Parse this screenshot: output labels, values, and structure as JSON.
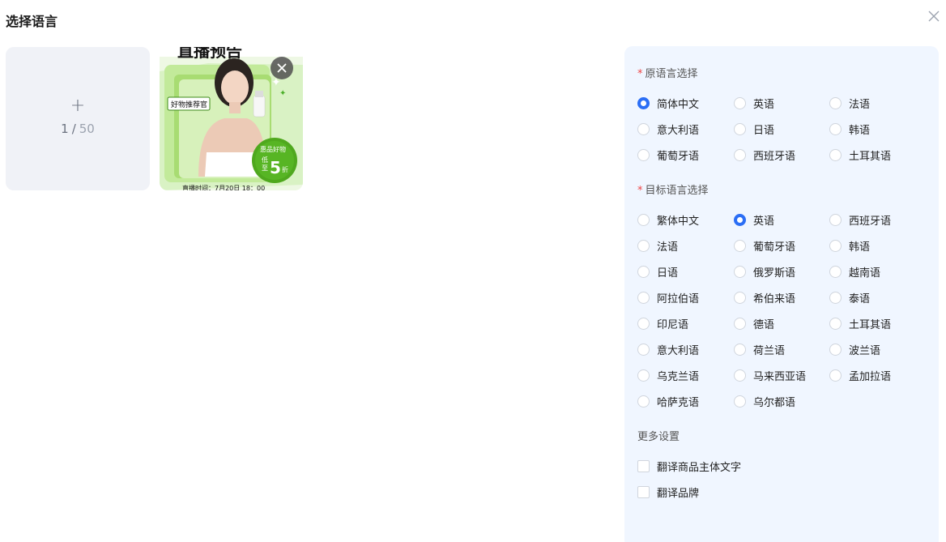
{
  "dialog": {
    "title": "选择语言"
  },
  "upload": {
    "plus": "+",
    "current": "1",
    "separator": "/",
    "total": "50"
  },
  "thumbnail": {
    "top_text": "直播预告",
    "badge": "好物推荐官",
    "promo_line1": "惠品好物",
    "promo_low": "低",
    "promo_to": "至",
    "promo_number": "5",
    "promo_unit": "折",
    "bottom_text": "直播时间：7月20日 18：00"
  },
  "source_language": {
    "label": "原语言选择",
    "required_mark": "*",
    "options": [
      "简体中文",
      "英语",
      "法语",
      "意大利语",
      "日语",
      "韩语",
      "葡萄牙语",
      "西班牙语",
      "土耳其语"
    ],
    "selected": "简体中文"
  },
  "target_language": {
    "label": "目标语言选择",
    "required_mark": "*",
    "options": [
      "繁体中文",
      "英语",
      "西班牙语",
      "法语",
      "葡萄牙语",
      "韩语",
      "日语",
      "俄罗斯语",
      "越南语",
      "阿拉伯语",
      "希伯来语",
      "泰语",
      "印尼语",
      "德语",
      "土耳其语",
      "意大利语",
      "荷兰语",
      "波兰语",
      "乌克兰语",
      "马来西亚语",
      "孟加拉语",
      "哈萨克语",
      "乌尔都语"
    ],
    "selected": "英语"
  },
  "more_settings": {
    "label": "更多设置",
    "options": [
      "翻译商品主体文字",
      "翻译品牌"
    ]
  },
  "colors": {
    "accent": "#2b6ef5",
    "required": "#ef4444",
    "panel_bg": "#f0f6ff",
    "tile_bg": "#f0f2f7"
  }
}
